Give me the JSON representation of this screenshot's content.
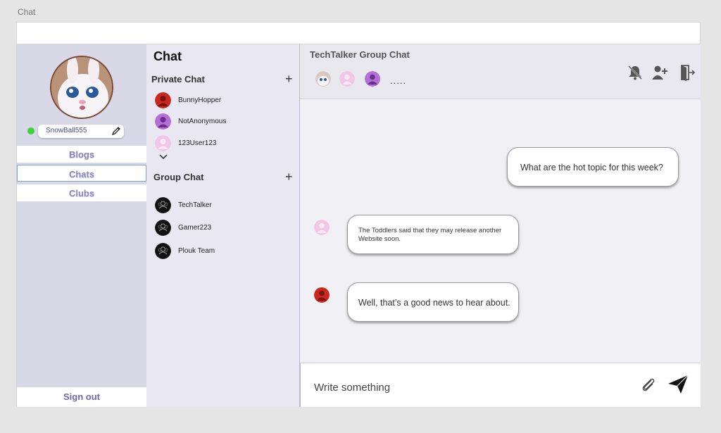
{
  "frame_label": "Chat",
  "sidebar": {
    "username": "SnowBall555",
    "nav": [
      {
        "label": "Blogs"
      },
      {
        "label": "Chats"
      },
      {
        "label": "Clubs"
      }
    ],
    "signout": "Sign out"
  },
  "chatlist": {
    "title": "Chat",
    "private_title": "Private Chat",
    "private": [
      {
        "name": "BunnyHopper"
      },
      {
        "name": "NotAnonymous"
      },
      {
        "name": "123User123"
      }
    ],
    "group_title": "Group Chat",
    "groups": [
      {
        "name": "TechTalker"
      },
      {
        "name": "Gamer223"
      },
      {
        "name": "Plouk Team"
      }
    ],
    "add_symbol": "+"
  },
  "conversation": {
    "title": "TechTalker Group Chat",
    "more": ".....",
    "messages": [
      {
        "text": "What are the hot topic for this week?"
      },
      {
        "text": "The Toddlers said that they may release another Website soon."
      },
      {
        "text": "Well, that’s a good news to hear about."
      }
    ],
    "composer_placeholder": "Write something"
  },
  "colors": {
    "online": "#3ad43a",
    "nav_text": "#8a86c4",
    "avatar_red": "#c8281e",
    "avatar_purple": "#b46fd6",
    "avatar_pink": "#f0c7e6"
  }
}
